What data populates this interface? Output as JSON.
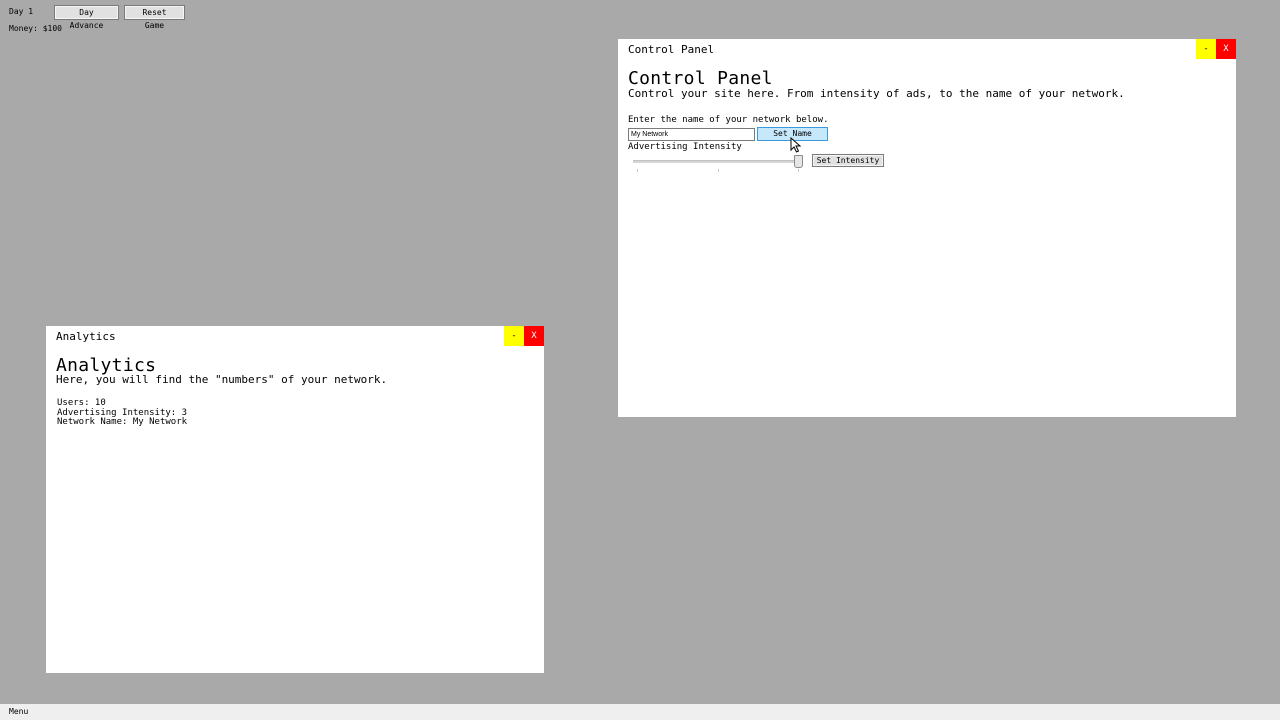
{
  "topbar": {
    "day": "Day 1",
    "money": "Money: $100",
    "day_advance_label": "Day Advance",
    "reset_game_label": "Reset Game"
  },
  "control_panel": {
    "title": "Control Panel",
    "heading": "Control Panel",
    "description": "Control your site here. From intensity of ads, to the name of your network.",
    "name_prompt": "Enter the name of your network below.",
    "name_input_value": "My Network",
    "set_name_label": "Set Name",
    "ad_intensity_label": "Advertising Intensity",
    "set_intensity_label": "Set Intensity",
    "slider": {
      "min": 1,
      "max": 3,
      "value": 3
    },
    "minimize_label": "-",
    "close_label": "X"
  },
  "analytics": {
    "title": "Analytics",
    "heading": "Analytics",
    "description": "Here, you will find the \"numbers\" of your network.",
    "users": "Users: 10",
    "ad_intensity": "Advertising Intensity: 3",
    "network_name": "Network Name: My Network",
    "minimize_label": "-",
    "close_label": "X"
  },
  "taskbar": {
    "menu_label": "Menu"
  },
  "colors": {
    "desktop": "#a9a9a9",
    "minimize": "#ffff00",
    "close": "#ff0000",
    "highlight_button": "#c7e7fb"
  },
  "icons": {
    "cursor": "mouse-pointer-icon"
  }
}
